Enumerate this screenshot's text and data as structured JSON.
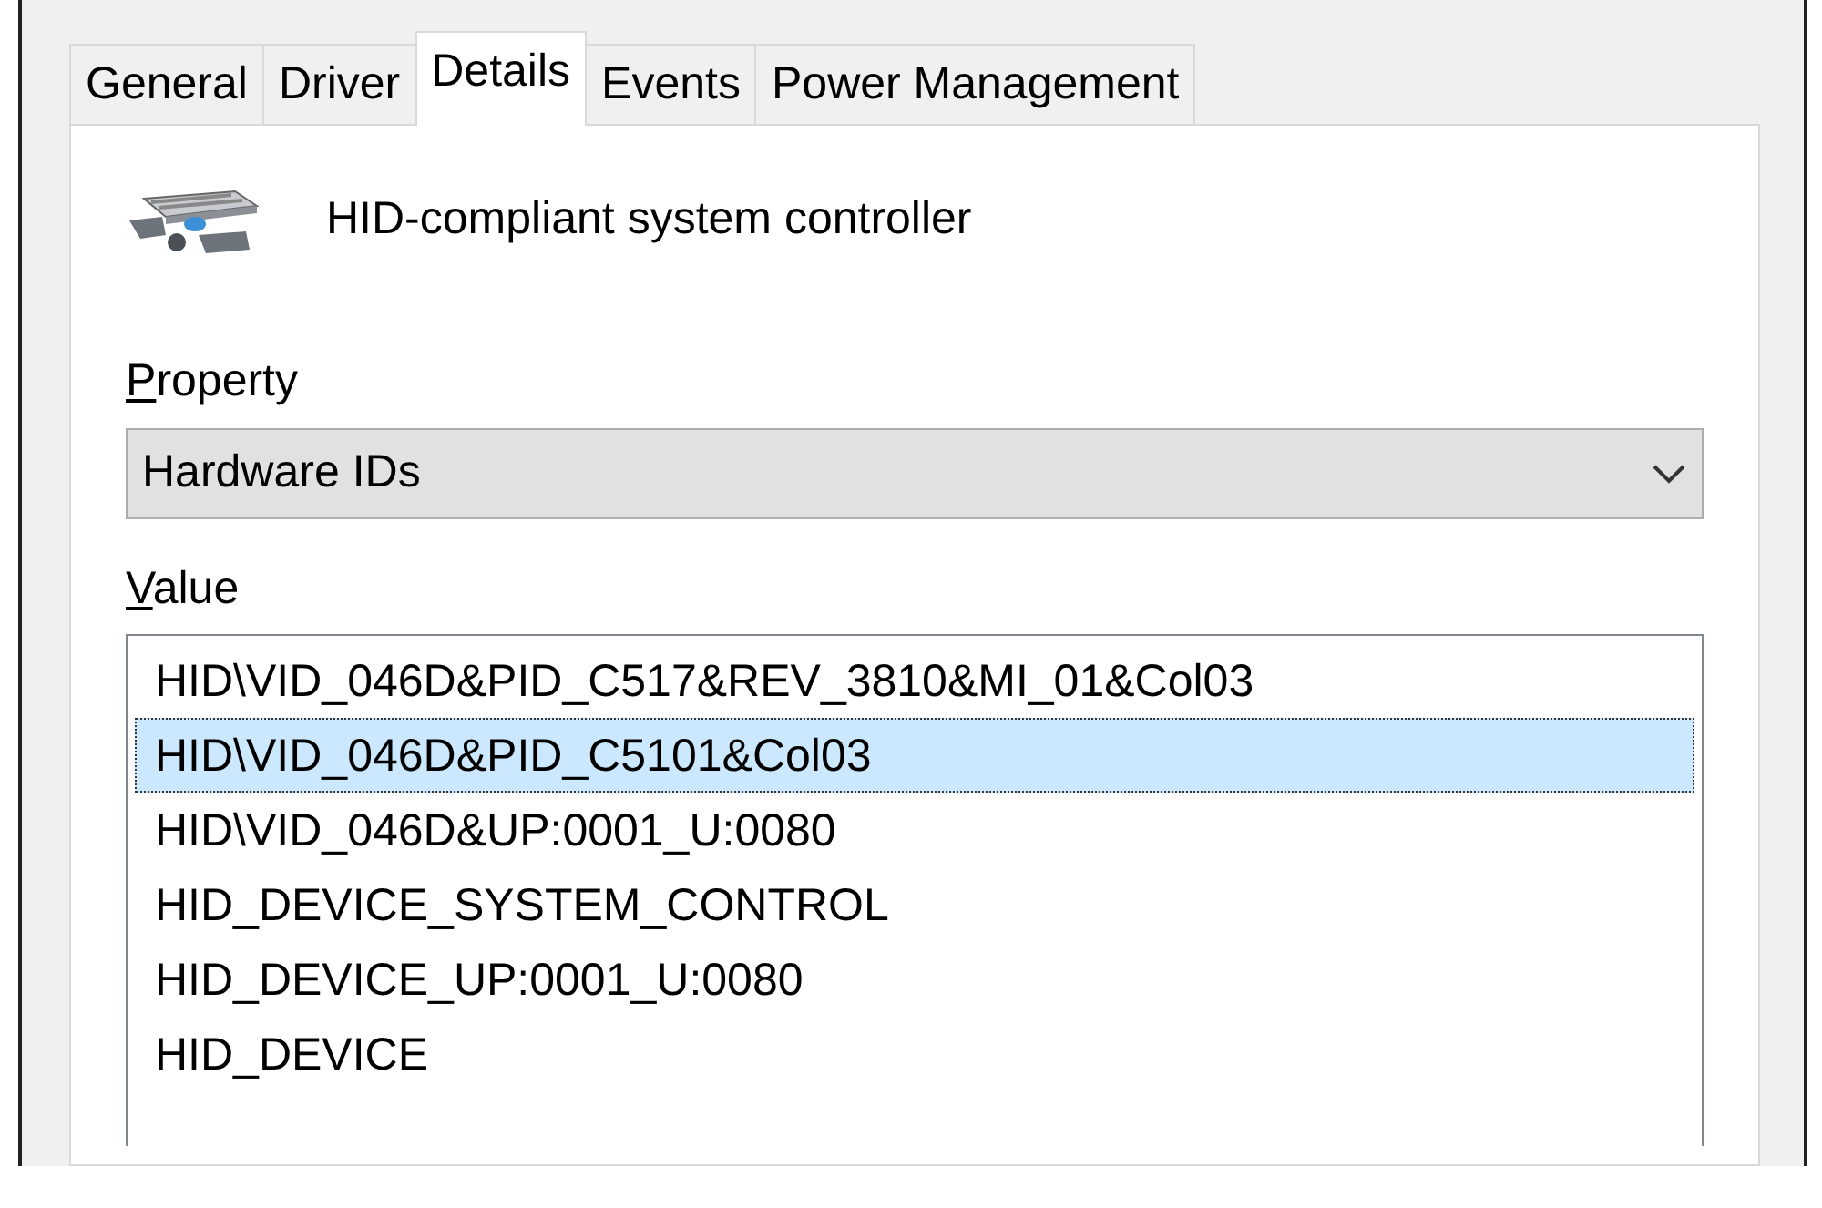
{
  "tabs": [
    {
      "label": "General",
      "selected": false
    },
    {
      "label": "Driver",
      "selected": false
    },
    {
      "label": "Details",
      "selected": true
    },
    {
      "label": "Events",
      "selected": false
    },
    {
      "label": "Power Management",
      "selected": false
    }
  ],
  "device": {
    "name": "HID-compliant system controller"
  },
  "property": {
    "label": "Property",
    "value": "Hardware IDs"
  },
  "value": {
    "label": "Value",
    "items": [
      {
        "text": "HID\\VID_046D&PID_C517&REV_3810&MI_01&Col03",
        "selected": false
      },
      {
        "text": "HID\\VID_046D&PID_C5101&Col03",
        "selected": true
      },
      {
        "text": "HID\\VID_046D&UP:0001_U:0080",
        "selected": false
      },
      {
        "text": "HID_DEVICE_SYSTEM_CONTROL",
        "selected": false
      },
      {
        "text": "HID_DEVICE_UP:0001_U:0080",
        "selected": false
      },
      {
        "text": "HID_DEVICE",
        "selected": false
      }
    ]
  }
}
